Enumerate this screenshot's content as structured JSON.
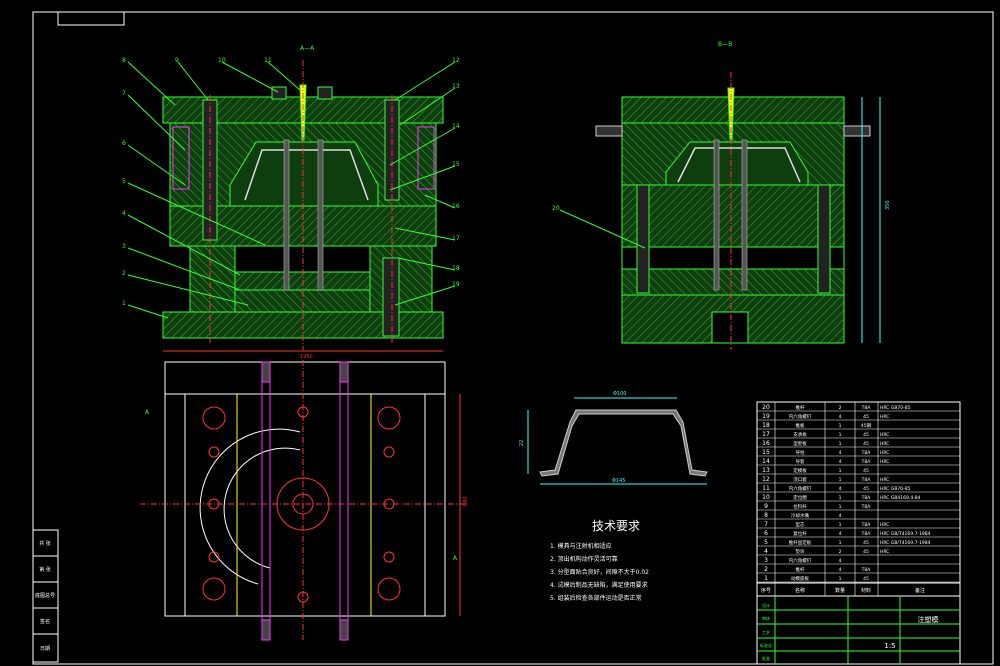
{
  "views": {
    "section_a": "A—A",
    "section_b": "B—B",
    "plan_marker_left": "A",
    "plan_marker_right": "A"
  },
  "balloons_left": [
    "8",
    "9",
    "10",
    "11",
    "12",
    "13",
    "14",
    "15",
    "16",
    "17",
    "18",
    "19",
    "7",
    "6",
    "5",
    "4",
    "3",
    "2",
    "1"
  ],
  "balloon_right": "20",
  "dims": {
    "plan_width": "1950",
    "plan_height": "680",
    "part_top": "Φ100",
    "part_bottom": "Φ145",
    "part_height": "22",
    "side_total": "350"
  },
  "tech": {
    "title": "技术要求",
    "items": [
      "1. 模具与注射机相适应",
      "2. 顶出机构动作灵活可靠",
      "3. 分型面贴合良好，间隙不大于0.02",
      "4. 试模后制品无缺陷，满足使用要求",
      "5. 组装后检查各部件运动是否正常"
    ]
  },
  "bom": {
    "rows": [
      [
        "20",
        "推杆",
        "2",
        "T8A",
        "HRC",
        "GB70-85"
      ],
      [
        "19",
        "内六角螺钉",
        "4",
        "45",
        "HRC",
        ""
      ],
      [
        "18",
        "推板",
        "1",
        "45钢",
        "",
        ""
      ],
      [
        "17",
        "支承板",
        "1",
        "45",
        "HRC",
        ""
      ],
      [
        "16",
        "型腔板",
        "1",
        "45",
        "HRC",
        ""
      ],
      [
        "15",
        "导柱",
        "4",
        "T8A",
        "HRC",
        ""
      ],
      [
        "14",
        "导套",
        "4",
        "T8A",
        "HRC",
        ""
      ],
      [
        "13",
        "定模板",
        "1",
        "45",
        "",
        ""
      ],
      [
        "12",
        "浇口套",
        "1",
        "T8A",
        "HRC",
        ""
      ],
      [
        "11",
        "内六角螺钉",
        "4",
        "45",
        "HRC",
        "GB70-85"
      ],
      [
        "10",
        "定位圈",
        "1",
        "T8A",
        "HRC",
        "GB4169.4-84"
      ],
      [
        "9",
        "拉料杆",
        "1",
        "T8A",
        "",
        ""
      ],
      [
        "8",
        "冷却水嘴",
        "4",
        "",
        "",
        ""
      ],
      [
        "7",
        "型芯",
        "1",
        "T8A",
        "HRC",
        ""
      ],
      [
        "6",
        "复位杆",
        "4",
        "T8A",
        "HRC",
        "GB/T4169.7-1984"
      ],
      [
        "5",
        "推杆固定板",
        "1",
        "45",
        "HRC",
        "GB/T4169.7-1984"
      ],
      [
        "4",
        "垫块",
        "2",
        "45",
        "HRC",
        ""
      ],
      [
        "3",
        "内六角螺钉",
        "4",
        "",
        "",
        ""
      ],
      [
        "2",
        "推杆",
        "4",
        "T8A",
        "",
        ""
      ],
      [
        "1",
        "动模座板",
        "1",
        "45",
        "",
        ""
      ]
    ],
    "header": [
      "序号",
      "名称",
      "数量",
      "材料",
      "备注"
    ],
    "title_block": {
      "name": "注塑模",
      "scale": "1:5",
      "labels": [
        "设计",
        "审核",
        "工艺",
        "标准化",
        "批准"
      ]
    }
  },
  "left_strip": [
    "共 张",
    "第 张",
    "底图总号",
    "签名",
    "日期"
  ],
  "colors": {
    "background": "#000000",
    "frame": "#ffffff",
    "hatch": "#2a8a2a",
    "green_line": "#33ff33",
    "red_line": "#ff3333",
    "cyan_line": "#33ffff",
    "yellow_line": "#ffff00",
    "magenta_line": "#ff33ff",
    "part_fill": "#b0b0b0"
  }
}
